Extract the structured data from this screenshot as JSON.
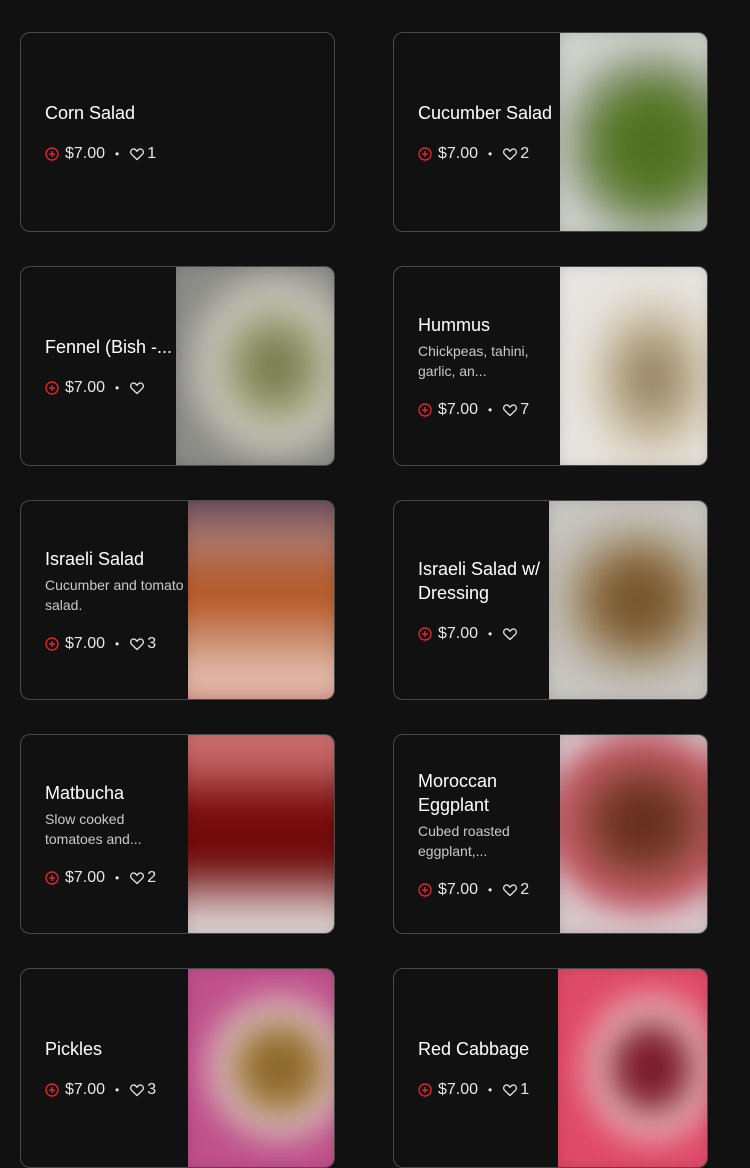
{
  "menu": {
    "items": [
      {
        "name": "Corn Salad",
        "desc": "",
        "price": "$7.00",
        "likes": "1",
        "has_image": false
      },
      {
        "name": "Cucumber Salad",
        "desc": "",
        "price": "$7.00",
        "likes": "2",
        "has_image": true
      },
      {
        "name": "Fennel (Bish -...",
        "desc": "",
        "price": "$7.00",
        "likes": "",
        "has_image": true
      },
      {
        "name": "Hummus",
        "desc": "Chickpeas, tahini, garlic, an...",
        "price": "$7.00",
        "likes": "7",
        "has_image": true
      },
      {
        "name": "Israeli Salad",
        "desc": "Cucumber and tomato salad.",
        "price": "$7.00",
        "likes": "3",
        "has_image": true
      },
      {
        "name": "Israeli Salad w/ Dressing",
        "desc": "",
        "price": "$7.00",
        "likes": "",
        "has_image": true
      },
      {
        "name": "Matbucha",
        "desc": "Slow cooked tomatoes and...",
        "price": "$7.00",
        "likes": "2",
        "has_image": true
      },
      {
        "name": "Moroccan Eggplant",
        "desc": "Cubed roasted eggplant,...",
        "price": "$7.00",
        "likes": "2",
        "has_image": true
      },
      {
        "name": "Pickles",
        "desc": "",
        "price": "$7.00",
        "likes": "3",
        "has_image": true
      },
      {
        "name": "Red Cabbage",
        "desc": "",
        "price": "$7.00",
        "likes": "1",
        "has_image": true
      }
    ],
    "separator": "•",
    "icons": {
      "add": "plus-circle-icon",
      "like": "heart-icon"
    },
    "colors": {
      "accent": "#e0242f",
      "background": "#111111",
      "border": "#4a4a4a"
    }
  }
}
